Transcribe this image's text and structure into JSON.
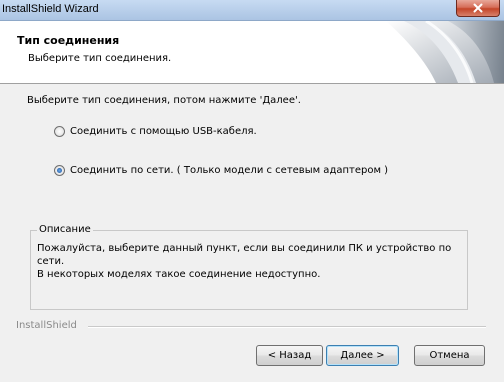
{
  "window": {
    "title": "InstallShield Wizard",
    "close_icon": "close-icon"
  },
  "header": {
    "title": "Тип соединения",
    "subtitle": "Выберите тип соединения."
  },
  "main": {
    "instruction": "Выберите тип соединения, потом нажмите 'Далее'.",
    "options": [
      {
        "label": "Соединить с помощью USB-кабеля.",
        "checked": false
      },
      {
        "label": "Соединить по сети. ( Только модели с сетевым адаптером )",
        "checked": true
      }
    ],
    "description": {
      "legend": "Описание",
      "line1": "Пожалуйста, выберите данный пункт, если вы соединили ПК и устройство по сети.",
      "line2": "В некоторых моделях такое соединение недоступно."
    }
  },
  "footer": {
    "brand": "InstallShield",
    "back_label": "< Назад",
    "next_label": "Далее >",
    "cancel_label": "Отмена"
  }
}
